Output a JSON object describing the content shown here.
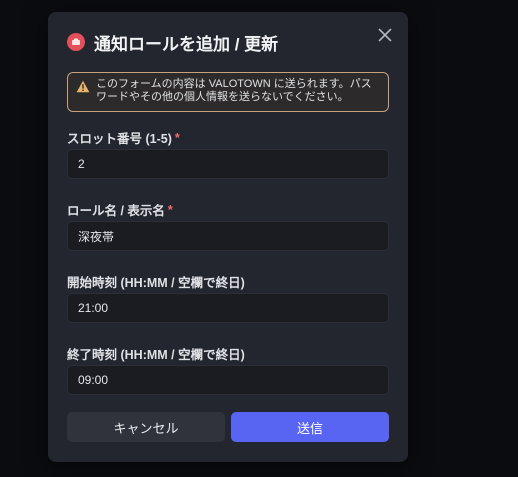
{
  "dialog": {
    "title": "通知ロールを追加 / 更新",
    "icon": "role-badge-icon",
    "close_icon": "close-icon"
  },
  "warning": {
    "icon": "warning-triangle-icon",
    "text": "このフォームの内容は VALOTOWN に送られます。パスワードやその他の個人情報を送らないでください。"
  },
  "fields": [
    {
      "label": "スロット番号 (1-5)",
      "required": "*",
      "value": "2"
    },
    {
      "label": "ロール名 / 表示名",
      "required": "*",
      "value": "深夜帯"
    },
    {
      "label": "開始時刻 (HH:MM / 空欄で終日)",
      "required": "",
      "value": "21:00"
    },
    {
      "label": "終了時刻 (HH:MM / 空欄で終日)",
      "required": "",
      "value": "09:00"
    }
  ],
  "buttons": {
    "cancel_label": "キャンセル",
    "submit_label": "送信"
  },
  "colors": {
    "accent": "#5865f2",
    "danger": "#e3505a",
    "warning_border": "#c9a27a",
    "modal_bg": "#23262f"
  }
}
